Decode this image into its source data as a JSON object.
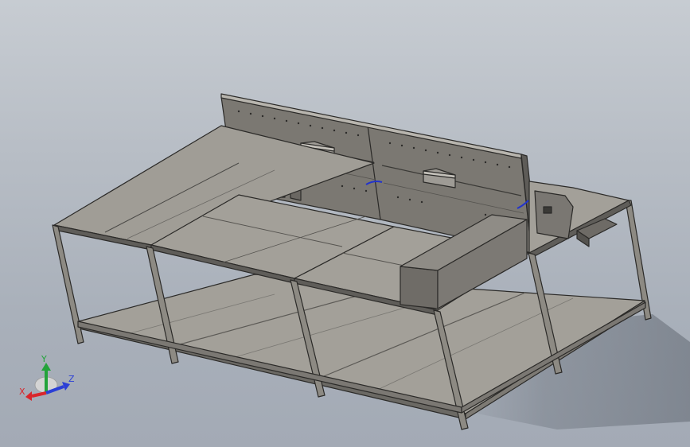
{
  "viewport": {
    "background_top": "#c7ccd2",
    "background_bottom": "#a3aab5"
  },
  "model": {
    "metal_color": "#8d8a83",
    "panel_color": "#7b7872",
    "shelf_color": "#a09d96",
    "edge_color": "#2b2a28",
    "highlight_color": "#b8b5ae"
  },
  "triad": {
    "x_label": "X",
    "y_label": "Y",
    "z_label": "Z",
    "x_color": "#d9262b",
    "y_color": "#23a33a",
    "z_color": "#2b3fd6"
  }
}
